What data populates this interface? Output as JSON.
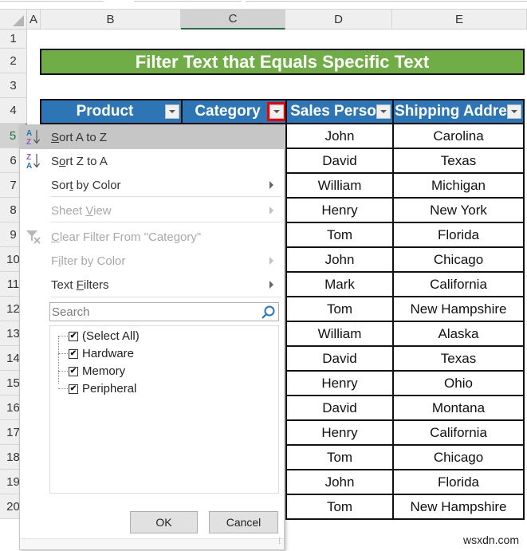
{
  "sheet": {
    "columns": [
      "A",
      "B",
      "C",
      "D",
      "E"
    ],
    "selected_column": "C",
    "rows": [
      "1",
      "2",
      "3",
      "4",
      "5",
      "6",
      "7",
      "8",
      "9",
      "10",
      "11",
      "12",
      "13",
      "14",
      "15",
      "16",
      "17",
      "18",
      "19",
      "20"
    ],
    "selected_row": "5",
    "title": "Filter Text that Equals Specific Text",
    "table": {
      "headers": [
        "Product",
        "Category",
        "Sales Perso",
        "Shipping Addre"
      ],
      "sales_person": [
        "John",
        "David",
        "William",
        "Henry",
        "Tom",
        "John",
        "Mark",
        "Tom",
        "William",
        "David",
        "Henry",
        "David",
        "Henry",
        "Tom",
        "John",
        "Tom"
      ],
      "shipping_address": [
        "Carolina",
        "Texas",
        "Michigan",
        "New York",
        "Florida",
        "Chicago",
        "California",
        "New Hampshire",
        "Alaska",
        "Texas",
        "Ohio",
        "Montana",
        "California",
        "Chicago",
        "Florida",
        "New Hampshire"
      ]
    }
  },
  "filter_menu": {
    "items": [
      {
        "pre": "",
        "u": "S",
        "post": "ort A to Z",
        "icon": "sort-a-to-z-icon",
        "enabled": true,
        "highlighted": true,
        "submenu": false
      },
      {
        "pre": "S",
        "u": "o",
        "post": "rt Z to A",
        "icon": "sort-z-to-a-icon",
        "enabled": true,
        "highlighted": false,
        "submenu": false
      },
      {
        "pre": "Sor",
        "u": "t",
        "post": " by Color",
        "icon": "",
        "enabled": true,
        "highlighted": false,
        "submenu": true
      },
      {
        "pre": "Sheet ",
        "u": "V",
        "post": "iew",
        "icon": "",
        "enabled": false,
        "highlighted": false,
        "submenu": true
      },
      {
        "pre": "",
        "u": "C",
        "post": "lear Filter From \"Category\"",
        "icon": "clear-filter-icon",
        "enabled": false,
        "highlighted": false,
        "submenu": false
      },
      {
        "pre": "F",
        "u": "i",
        "post": "lter by Color",
        "icon": "",
        "enabled": false,
        "highlighted": false,
        "submenu": true
      },
      {
        "pre": "Text ",
        "u": "F",
        "post": "ilters",
        "icon": "",
        "enabled": true,
        "highlighted": false,
        "submenu": true
      }
    ],
    "search_placeholder": "Search",
    "checklist": [
      {
        "label": "(Select All)",
        "checked": true
      },
      {
        "label": "Hardware",
        "checked": true
      },
      {
        "label": "Memory",
        "checked": true
      },
      {
        "label": "Peripheral",
        "checked": true
      }
    ],
    "ok_label": "OK",
    "cancel_label": "Cancel"
  },
  "watermark": "wsxdn.com",
  "colors": {
    "title_bg": "#70ad47",
    "header_bg": "#2e75b6",
    "active_dropdown_outline": "#e00000",
    "selection_green": "#217346"
  }
}
